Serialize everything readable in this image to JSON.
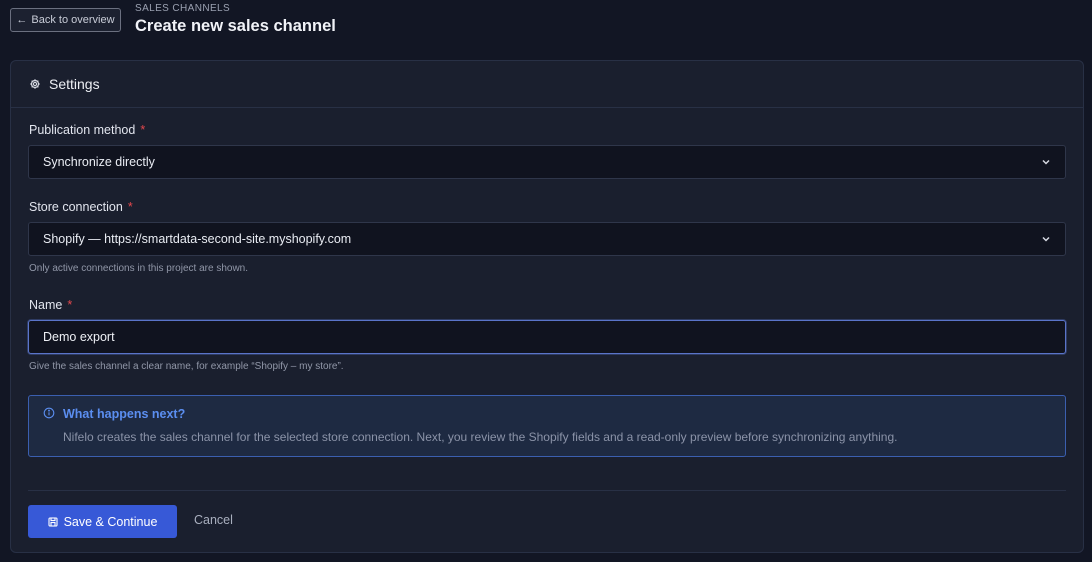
{
  "header": {
    "back_label": "Back to overview",
    "eyebrow": "SALES CHANNELS",
    "title": "Create new sales channel"
  },
  "card": {
    "title": "Settings",
    "publication": {
      "label": "Publication method",
      "required": "*",
      "value": "Synchronize directly"
    },
    "store": {
      "label": "Store connection",
      "required": "*",
      "value": "Shopify — https://smartdata-second-site.myshopify.com",
      "hint": "Only active connections in this project are shown."
    },
    "name": {
      "label": "Name",
      "required": "*",
      "value": "Demo export",
      "hint": "Give the sales channel a clear name, for example “Shopify – my store”."
    },
    "info": {
      "title": "What happens next?",
      "text": "Nifelo creates the sales channel for the selected store connection. Next, you review the Shopify fields and a read-only preview before synchronizing anything."
    },
    "actions": {
      "save_label": "Save & Continue",
      "cancel_label": "Cancel"
    }
  },
  "colors": {
    "accent": "#3759d7",
    "info": "#5b8ef0",
    "required": "#e5484d",
    "background": "#121624"
  }
}
